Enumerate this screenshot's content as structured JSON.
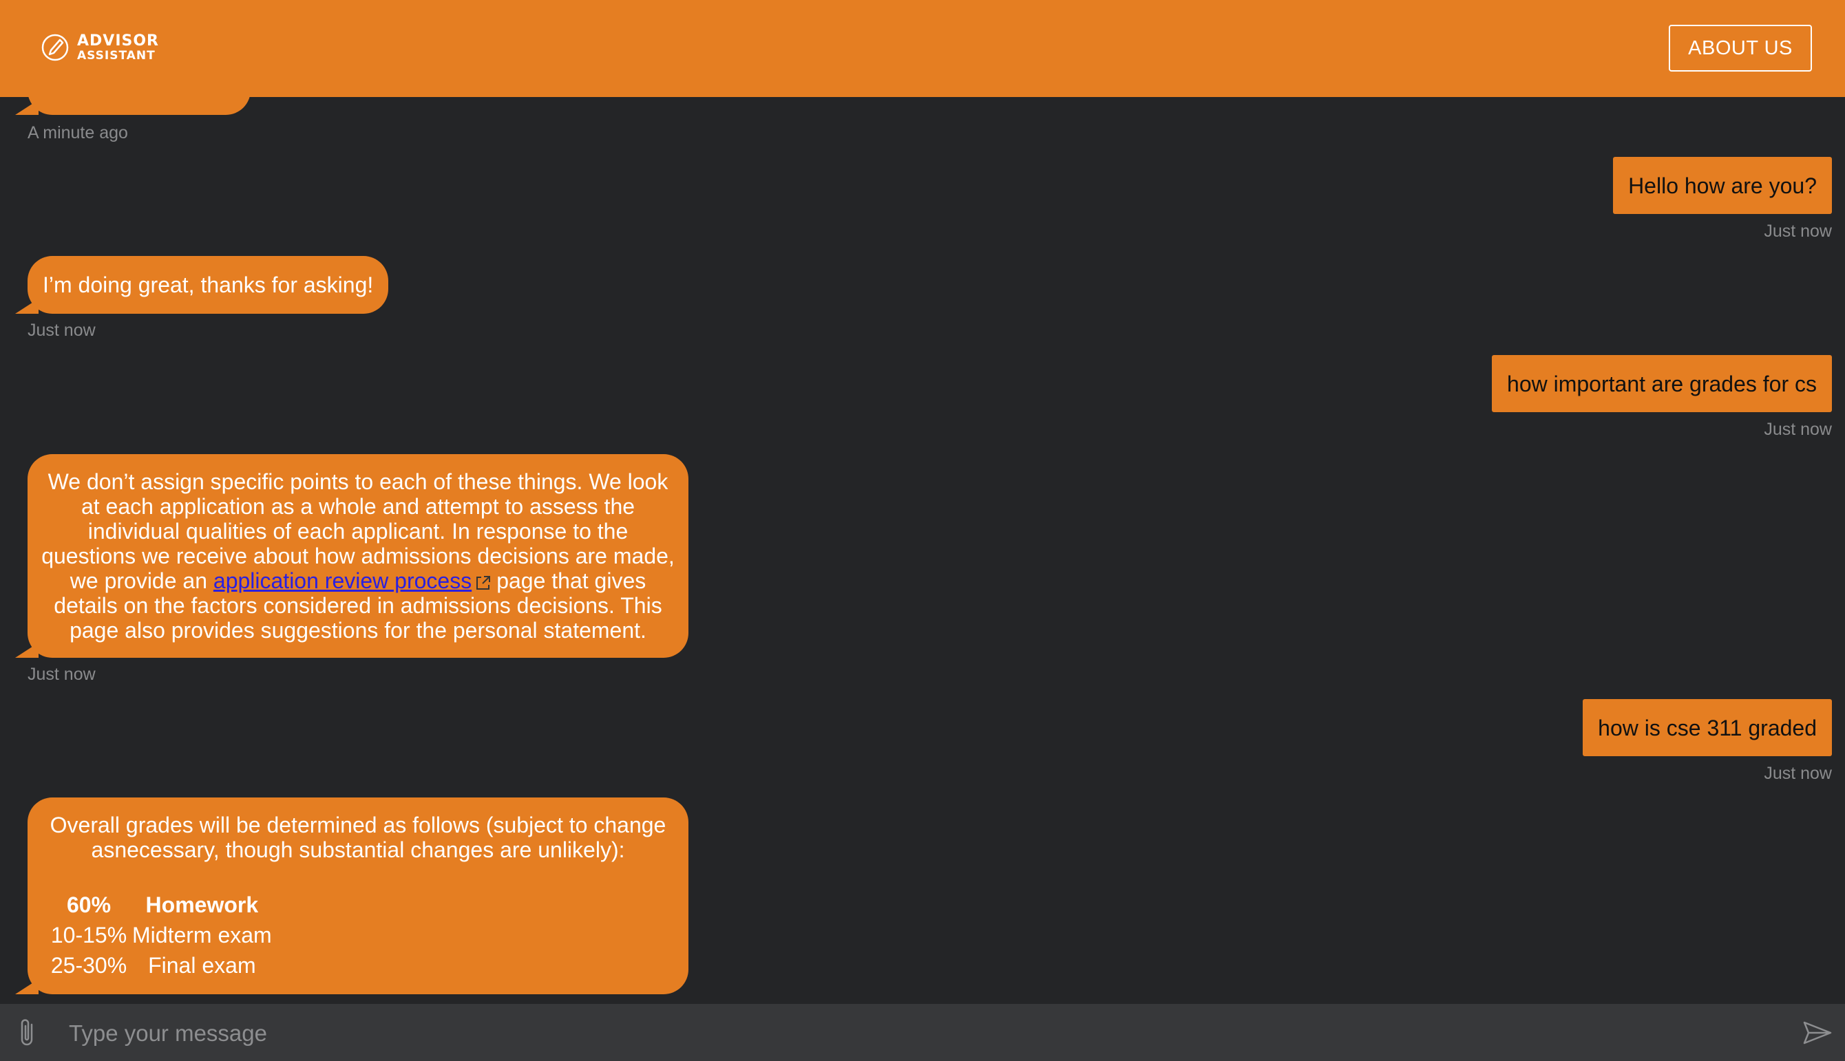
{
  "header": {
    "logo_line1": "ADVISOR",
    "logo_line2": "ASSISTANT",
    "about_label": "ABOUT US"
  },
  "messages": {
    "m0": {
      "time": "A minute ago"
    },
    "m1": {
      "text": "Hello how are you?",
      "time": "Just now"
    },
    "m2": {
      "text": "I’m doing great, thanks for asking!",
      "time": "Just now"
    },
    "m3": {
      "text": "how important are grades for cs",
      "time": "Just now"
    },
    "m4": {
      "text_before": "We don’t assign specific points to each of these things. We look at each application as a whole and attempt to assess the individual qualities of each applicant. In response to the questions we receive about how admissions decisions are made, we provide an",
      "link_text": "application review process",
      "text_after": "page that gives details on the factors considered in admissions decisions. This page also provides suggestions for the personal statement.",
      "time": "Just now"
    },
    "m5": {
      "text": "how is cse 311 graded",
      "time": "Just now"
    },
    "m6": {
      "intro": "Overall grades will be determined as follows (subject to change asnecessary, though substantial changes are unlikely):",
      "rows": [
        {
          "pct": "60%",
          "item": "Homework"
        },
        {
          "pct": "10-15%",
          "item": "Midterm exam"
        },
        {
          "pct": "25-30%",
          "item": "Final exam"
        }
      ]
    }
  },
  "composer": {
    "placeholder": "Type your message"
  },
  "colors": {
    "accent": "#e57e22",
    "background": "#242527",
    "composer": "#37383a",
    "link": "#2a1fe0"
  },
  "icons": {
    "logo": "pencil-circle-icon",
    "attach": "paperclip-icon",
    "send": "send-icon",
    "external": "external-link-icon"
  }
}
